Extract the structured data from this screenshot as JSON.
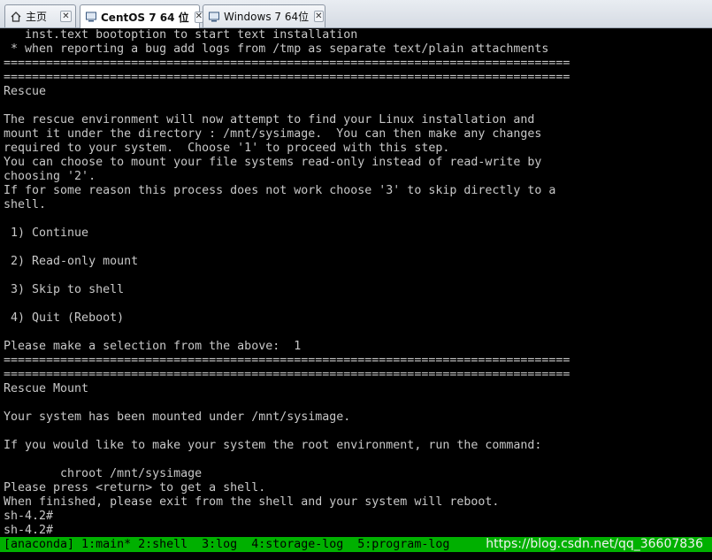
{
  "tabs": [
    {
      "label": "主页",
      "icon": "home-icon",
      "active": false
    },
    {
      "label": "CentOS 7 64 位",
      "icon": "vm-icon",
      "active": true
    },
    {
      "label": "Windows 7 64位",
      "icon": "vm-icon",
      "active": false
    }
  ],
  "terminal": {
    "lines": [
      "   inst.text bootoption to start text installation",
      " * when reporting a bug add logs from /tmp as separate text/plain attachments",
      "================================================================================",
      "================================================================================",
      "Rescue",
      "",
      "The rescue environment will now attempt to find your Linux installation and",
      "mount it under the directory : /mnt/sysimage.  You can then make any changes",
      "required to your system.  Choose '1' to proceed with this step.",
      "You can choose to mount your file systems read-only instead of read-write by",
      "choosing '2'.",
      "If for some reason this process does not work choose '3' to skip directly to a",
      "shell.",
      "",
      " 1) Continue",
      "",
      " 2) Read-only mount",
      "",
      " 3) Skip to shell",
      "",
      " 4) Quit (Reboot)",
      "",
      "Please make a selection from the above:  1",
      "================================================================================",
      "================================================================================",
      "Rescue Mount",
      "",
      "Your system has been mounted under /mnt/sysimage.",
      "",
      "If you would like to make your system the root environment, run the command:",
      "",
      "        chroot /mnt/sysimage",
      "Please press <return> to get a shell.",
      "When finished, please exit from the shell and your system will reboot.",
      "sh-4.2#",
      "sh-4.2#"
    ]
  },
  "statusbar": {
    "text": "[anaconda] 1:main* 2:shell  3:log  4:storage-log  5:program-log",
    "watermark": "https://blog.csdn.net/qq_36607836"
  },
  "colors": {
    "terminal_bg": "#000000",
    "terminal_fg": "#c8c8c8",
    "statusbar_bg": "#00b000"
  }
}
